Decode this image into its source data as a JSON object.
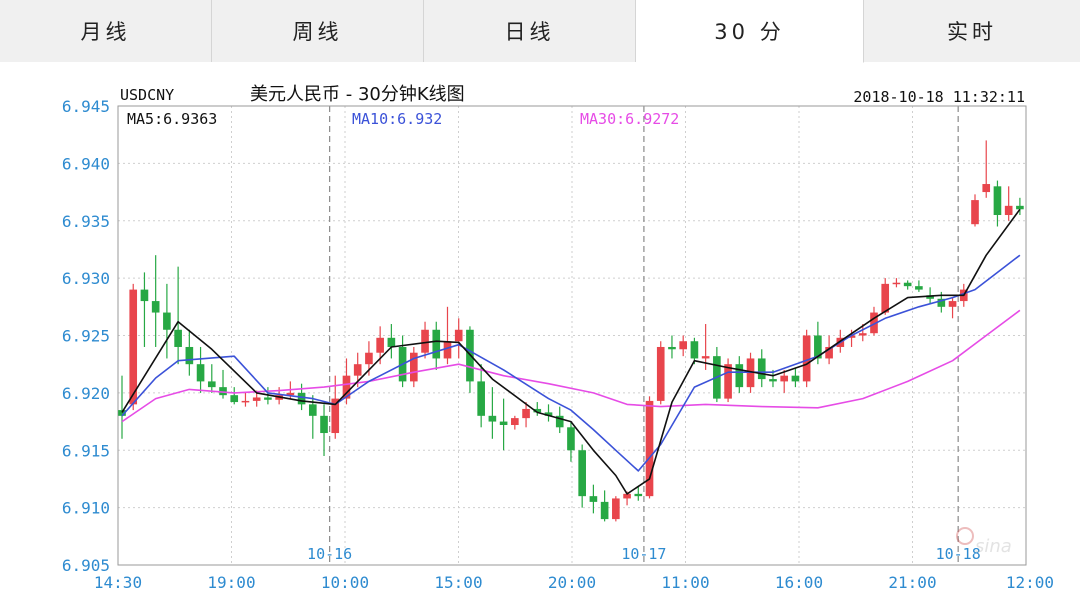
{
  "tabs": [
    {
      "label": "月线",
      "active": false
    },
    {
      "label": "周线",
      "active": false
    },
    {
      "label": "日线",
      "active": false
    },
    {
      "label": "30 分",
      "active": true
    },
    {
      "label": "实时",
      "active": false
    }
  ],
  "chart_header": {
    "symbol": "USDCNY",
    "title": "美元人民币 - 30分钟K线图",
    "datetime": "2018-10-18 11:32:11",
    "ma5_label": "MA5:6.9363",
    "ma10_label": "MA10:6.932",
    "ma30_label": "MA30:6.9272"
  },
  "watermark": "sina",
  "colors": {
    "up": "#e8454c",
    "down": "#27a844",
    "ma5": "#111111",
    "ma10": "#3b52d8",
    "ma30": "#e64ce6",
    "axis_label": "#2e8bd0",
    "grid": "#cfcfcf"
  },
  "chart_data": {
    "type": "candlestick",
    "ylim": [
      6.905,
      6.945
    ],
    "y_ticks": [
      "6.945",
      "6.940",
      "6.935",
      "6.930",
      "6.925",
      "6.920",
      "6.915",
      "6.910",
      "6.905"
    ],
    "x_ticks": [
      "14:30",
      "19:00",
      "10:00",
      "15:00",
      "20:00",
      "11:00",
      "16:00",
      "21:00",
      "12:00"
    ],
    "date_markers": [
      {
        "label": "10-16",
        "index": 19
      },
      {
        "label": "10-17",
        "index": 47
      },
      {
        "label": "10-18",
        "index": 75
      }
    ],
    "grid": true,
    "candles": [
      [
        6.9185,
        6.9215,
        6.916,
        6.918
      ],
      [
        6.919,
        6.9295,
        6.9185,
        6.929
      ],
      [
        6.929,
        6.9305,
        6.924,
        6.928
      ],
      [
        6.928,
        6.932,
        6.924,
        6.927
      ],
      [
        6.927,
        6.9295,
        6.923,
        6.9255
      ],
      [
        6.9255,
        6.931,
        6.9225,
        6.924
      ],
      [
        6.924,
        6.9255,
        6.9215,
        6.9225
      ],
      [
        6.9225,
        6.924,
        6.92,
        6.921
      ],
      [
        6.921,
        6.9225,
        6.92,
        6.9205
      ],
      [
        6.9205,
        6.922,
        6.9195,
        6.9198
      ],
      [
        6.9198,
        6.9205,
        6.919,
        6.9192
      ],
      [
        6.9192,
        6.92,
        6.9188,
        6.9193
      ],
      [
        6.9193,
        6.9202,
        6.9188,
        6.9196
      ],
      [
        6.9196,
        6.9205,
        6.919,
        6.9194
      ],
      [
        6.9194,
        6.9205,
        6.919,
        6.9198
      ],
      [
        6.9198,
        6.921,
        6.9195,
        6.92
      ],
      [
        6.92,
        6.9208,
        6.9185,
        6.919
      ],
      [
        6.919,
        6.9198,
        6.916,
        6.918
      ],
      [
        6.918,
        6.919,
        6.9145,
        6.9165
      ],
      [
        6.9165,
        6.9215,
        6.916,
        6.9195
      ],
      [
        6.9195,
        6.923,
        6.919,
        6.9215
      ],
      [
        6.9215,
        6.9235,
        6.9205,
        6.9225
      ],
      [
        6.9225,
        6.9245,
        6.9215,
        6.9235
      ],
      [
        6.9235,
        6.9258,
        6.9225,
        6.9248
      ],
      [
        6.9248,
        6.926,
        6.923,
        6.924
      ],
      [
        6.924,
        6.925,
        6.9205,
        6.921
      ],
      [
        6.921,
        6.924,
        6.9205,
        6.9235
      ],
      [
        6.9235,
        6.9262,
        6.923,
        6.9255
      ],
      [
        6.9255,
        6.9262,
        6.922,
        6.923
      ],
      [
        6.923,
        6.9275,
        6.9225,
        6.9245
      ],
      [
        6.9245,
        6.9265,
        6.923,
        6.9255
      ],
      [
        6.9255,
        6.9258,
        6.92,
        6.921
      ],
      [
        6.921,
        6.9225,
        6.917,
        6.918
      ],
      [
        6.918,
        6.9205,
        6.916,
        6.9175
      ],
      [
        6.9175,
        6.9195,
        6.915,
        6.9172
      ],
      [
        6.9172,
        6.918,
        6.9168,
        6.9178
      ],
      [
        6.9178,
        6.9192,
        6.917,
        6.9186
      ],
      [
        6.9186,
        6.9192,
        6.918,
        6.9183
      ],
      [
        6.9183,
        6.919,
        6.9175,
        6.918
      ],
      [
        6.918,
        6.9188,
        6.9165,
        6.917
      ],
      [
        6.917,
        6.9175,
        6.914,
        6.915
      ],
      [
        6.915,
        6.9155,
        6.91,
        6.911
      ],
      [
        6.911,
        6.912,
        6.9095,
        6.9105
      ],
      [
        6.9105,
        6.9115,
        6.9088,
        6.909
      ],
      [
        6.909,
        6.911,
        6.9088,
        6.9108
      ],
      [
        6.9108,
        6.9114,
        6.9102,
        6.9112
      ],
      [
        6.9112,
        6.9118,
        6.9106,
        6.911
      ],
      [
        6.911,
        6.9197,
        6.9108,
        6.9193
      ],
      [
        6.9193,
        6.9245,
        6.919,
        6.924
      ],
      [
        6.924,
        6.925,
        6.923,
        6.9238
      ],
      [
        6.9238,
        6.925,
        6.9232,
        6.9245
      ],
      [
        6.9245,
        6.9248,
        6.9225,
        6.923
      ],
      [
        6.923,
        6.926,
        6.922,
        6.9232
      ],
      [
        6.9232,
        6.924,
        6.9192,
        6.9195
      ],
      [
        6.9195,
        6.923,
        6.9192,
        6.9225
      ],
      [
        6.9225,
        6.9232,
        6.92,
        6.9205
      ],
      [
        6.9205,
        6.9235,
        6.92,
        6.923
      ],
      [
        6.923,
        6.9238,
        6.9205,
        6.9212
      ],
      [
        6.9212,
        6.922,
        6.9205,
        6.921
      ],
      [
        6.921,
        6.922,
        6.92,
        6.9215
      ],
      [
        6.9215,
        6.9222,
        6.9205,
        6.921
      ],
      [
        6.921,
        6.9255,
        6.9205,
        6.925
      ],
      [
        6.925,
        6.9262,
        6.9225,
        6.923
      ],
      [
        6.923,
        6.925,
        6.9225,
        6.924
      ],
      [
        6.924,
        6.9255,
        6.9235,
        6.9248
      ],
      [
        6.9248,
        6.9255,
        6.924,
        6.925
      ],
      [
        6.925,
        6.926,
        6.9245,
        6.9252
      ],
      [
        6.9252,
        6.9275,
        6.925,
        6.927
      ],
      [
        6.927,
        6.93,
        6.9268,
        6.9295
      ],
      [
        6.9295,
        6.93,
        6.9292,
        6.9296
      ],
      [
        6.9296,
        6.9298,
        6.929,
        6.9293
      ],
      [
        6.9293,
        6.9298,
        6.9288,
        6.929
      ],
      [
        6.9285,
        6.9292,
        6.9278,
        6.9282
      ],
      [
        6.9282,
        6.9288,
        6.927,
        6.9275
      ],
      [
        6.9275,
        6.9283,
        6.9265,
        6.928
      ],
      [
        6.928,
        6.9295,
        6.9275,
        6.929
      ],
      [
        6.9347,
        6.9373,
        6.9345,
        6.9368
      ],
      [
        6.9375,
        6.942,
        6.937,
        6.9382
      ],
      [
        6.938,
        6.9385,
        6.9345,
        6.9355
      ],
      [
        6.9355,
        6.938,
        6.935,
        6.9363
      ],
      [
        6.9363,
        6.937,
        6.9355,
        6.936
      ]
    ],
    "ma5": [
      [
        0,
        6.9183
      ],
      [
        5,
        6.9262
      ],
      [
        8,
        6.9238
      ],
      [
        12,
        6.92
      ],
      [
        16,
        6.9193
      ],
      [
        19,
        6.919
      ],
      [
        21,
        6.921
      ],
      [
        24,
        6.924
      ],
      [
        28,
        6.9245
      ],
      [
        30,
        6.9244
      ],
      [
        33,
        6.9212
      ],
      [
        37,
        6.9183
      ],
      [
        40,
        6.9175
      ],
      [
        42,
        6.915
      ],
      [
        44,
        6.9128
      ],
      [
        45,
        6.9112
      ],
      [
        47,
        6.9125
      ],
      [
        49,
        6.9192
      ],
      [
        51,
        6.9228
      ],
      [
        54,
        6.9222
      ],
      [
        58,
        6.9215
      ],
      [
        61,
        6.9225
      ],
      [
        64,
        6.9245
      ],
      [
        67,
        6.9265
      ],
      [
        70,
        6.9283
      ],
      [
        73,
        6.9285
      ],
      [
        75,
        6.9285
      ],
      [
        77,
        6.932
      ],
      [
        80,
        6.936
      ]
    ],
    "ma10": [
      [
        0,
        6.918
      ],
      [
        3,
        6.9213
      ],
      [
        5,
        6.9228
      ],
      [
        10,
        6.9232
      ],
      [
        13,
        6.92
      ],
      [
        17,
        6.9195
      ],
      [
        19,
        6.919
      ],
      [
        22,
        6.921
      ],
      [
        26,
        6.923
      ],
      [
        30,
        6.9242
      ],
      [
        34,
        6.922
      ],
      [
        38,
        6.9195
      ],
      [
        40,
        6.9185
      ],
      [
        42,
        6.9168
      ],
      [
        44,
        6.915
      ],
      [
        46,
        6.9132
      ],
      [
        48,
        6.9155
      ],
      [
        51,
        6.9205
      ],
      [
        54,
        6.9218
      ],
      [
        58,
        6.9218
      ],
      [
        62,
        6.9232
      ],
      [
        65,
        6.925
      ],
      [
        68,
        6.9265
      ],
      [
        71,
        6.9275
      ],
      [
        74,
        6.9283
      ],
      [
        76,
        6.929
      ],
      [
        78,
        6.9305
      ],
      [
        80,
        6.932
      ]
    ],
    "ma30": [
      [
        0,
        6.9175
      ],
      [
        3,
        6.9195
      ],
      [
        6,
        6.9203
      ],
      [
        10,
        6.92
      ],
      [
        14,
        6.9202
      ],
      [
        18,
        6.9205
      ],
      [
        22,
        6.921
      ],
      [
        26,
        6.9218
      ],
      [
        30,
        6.9225
      ],
      [
        34,
        6.9215
      ],
      [
        38,
        6.9208
      ],
      [
        42,
        6.92
      ],
      [
        45,
        6.919
      ],
      [
        48,
        6.9188
      ],
      [
        52,
        6.919
      ],
      [
        57,
        6.9188
      ],
      [
        62,
        6.9187
      ],
      [
        66,
        6.9195
      ],
      [
        70,
        6.921
      ],
      [
        74,
        6.9228
      ],
      [
        77,
        6.925
      ],
      [
        80,
        6.9272
      ]
    ]
  }
}
